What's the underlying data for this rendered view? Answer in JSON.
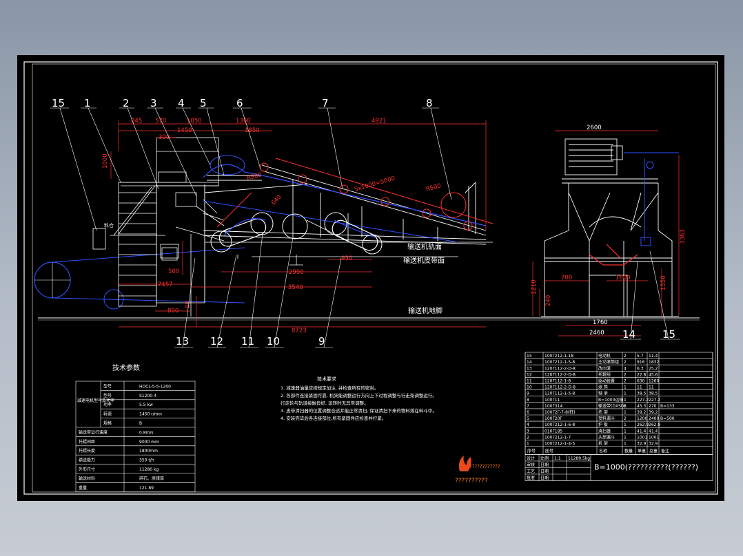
{
  "canvas": {
    "background": "#000000",
    "border_color": "#ffffff",
    "dim_color": "#ff3030",
    "hidden_color": "#3050ff",
    "part_color": "#ffffff",
    "text_color": "#ffffff"
  },
  "balloons_front": [
    "15",
    "1",
    "2",
    "3",
    "4",
    "5",
    "6",
    "7",
    "8"
  ],
  "balloons_bottom": [
    "13",
    "12",
    "11",
    "10",
    "9"
  ],
  "balloons_side": [
    "14",
    "15"
  ],
  "dimensions_front": {
    "d845": "845",
    "d570": "570",
    "d1050": "1050",
    "d1360": "1360",
    "d4921": "4921",
    "d1450": "1450",
    "d1850": "1850",
    "d300": "300",
    "d1000": "1000",
    "dslope": "5x1000=5000",
    "dr500": "R500",
    "dr500b": "R500",
    "d640": "640",
    "d500": "500",
    "d2457": "2457",
    "d800": "800",
    "d2990": "2990",
    "d3540": "3540",
    "d950": "950",
    "d8723": "8723",
    "d80": "80"
  },
  "dimensions_side": {
    "d2600": "2600",
    "d3363": "3363",
    "d1210": "1210",
    "d240": "240",
    "d700": "700",
    "d1600": "1600",
    "d1550": "1550",
    "d1760": "1760",
    "d2460": "2460"
  },
  "labels_front": {
    "guide": "输送机轨面",
    "belt": "输送机皮带面",
    "foundation": "输送机地脚",
    "small": "料仓"
  },
  "tech_params": {
    "title": "技术参数",
    "rows": [
      [
        "型号",
        "HDCL-5-5-1200"
      ],
      [
        "型号",
        "S1200-4"
      ],
      [
        "功率",
        "5.5 kw"
      ],
      [
        "转速",
        "1450 r/min"
      ],
      [
        "规格",
        "B"
      ],
      [
        "输送带运行速度",
        "0.8m/s"
      ],
      [
        "托辊间距",
        "9000 mm"
      ],
      [
        "托辊长度",
        "1800mm"
      ],
      [
        "输送能力",
        "350 t/h"
      ],
      [
        "外形尺寸",
        "11280 kg"
      ],
      [
        "输送材料",
        "碎石、原煤等"
      ],
      [
        "重量",
        "121.89"
      ]
    ],
    "group_label": "减速电机型号及功率"
  },
  "tech_requirements": {
    "title": "技术要求",
    "lines": [
      "1. 减速器油量应按规定加注, 并检查所有的密封。",
      "2. 各部件连接紧固可靠, 机架能调整运行方向上下过程调整与行走架调整运行。",
      "   行走轮与轨道接触良好, 运转时无异常调整。",
      "3. 皮带清扫器的位置调整合适并能正常清扫, 保证清扫下来的物料落在料斗中。",
      "4. 安装完毕后各连接部位,所有紧固件应检查并拧紧。"
    ]
  },
  "logo": {
    "text": "????????????",
    "caption": "??????????"
  },
  "bom": {
    "header": [
      "序号",
      "图号",
      "名称",
      "数量",
      "单重",
      "总重",
      "备注"
    ],
    "rows": [
      [
        "15",
        "100Γ212-1-18",
        "电动机",
        "2",
        "5.7",
        "11.4",
        ""
      ],
      [
        "14",
        "100Γ212-1-5-8",
        "主动滚筒组",
        "2",
        "916",
        "1832",
        ""
      ],
      [
        "13",
        "120Γ112-2-D-8",
        "改向滚",
        "4",
        "6.3",
        "25.2",
        ""
      ],
      [
        "12",
        "120Γ112-2-D-8",
        "托辊组",
        "2",
        "22.8",
        "45.6",
        ""
      ],
      [
        "11",
        "120Γ112-1-8",
        "驱动装置",
        "2",
        "630",
        "1260",
        ""
      ],
      [
        "10",
        "120Γ112-2-D-8",
        "滚 筒",
        "1",
        "11",
        "11",
        ""
      ],
      [
        "9",
        "120Γ112-1-5-8",
        "轴 承",
        "1",
        "38.5",
        "38.5",
        ""
      ],
      [
        "8",
        "100Γ11",
        "B=1000运输",
        "1",
        "227.2",
        "227.2",
        ""
      ],
      [
        "7",
        "100Γ314",
        "输送带(DXSD)",
        "6",
        "45.3",
        "270",
        "B=133"
      ],
      [
        "6",
        "100Γ2Γ-7-8(柱)",
        "托 架",
        "1",
        "39.2",
        "39.2",
        ""
      ],
      [
        "5",
        "100Γ20Γ",
        "受料漏斗",
        "2",
        "1200",
        "2400",
        "B=500"
      ],
      [
        "4",
        "100Γ212-1-6-8",
        "护 板",
        "1",
        "262.9",
        "262.9",
        ""
      ],
      [
        "3",
        "010Γ185",
        "清扫器",
        "1",
        "41.4",
        "41.4",
        ""
      ],
      [
        "2",
        "100Γ212-1-7",
        "头部漏斗",
        "1",
        "1001",
        "1001",
        ""
      ],
      [
        "1",
        "100Γ212-1-4-5",
        "机 架",
        "1",
        "32.9",
        "32.9",
        ""
      ]
    ],
    "title_block": {
      "r1c1": "设计",
      "r1c2": "比例",
      "r1c3": "1:1",
      "r1c4": "11289.5kg",
      "r2c1": "审核",
      "r2c2": "日期",
      "r3c1": "工艺",
      "r3c2": "日期",
      "r4c1": "批准",
      "r4c2": "日期",
      "name": "B=1000(??????????(??????)"
    }
  }
}
